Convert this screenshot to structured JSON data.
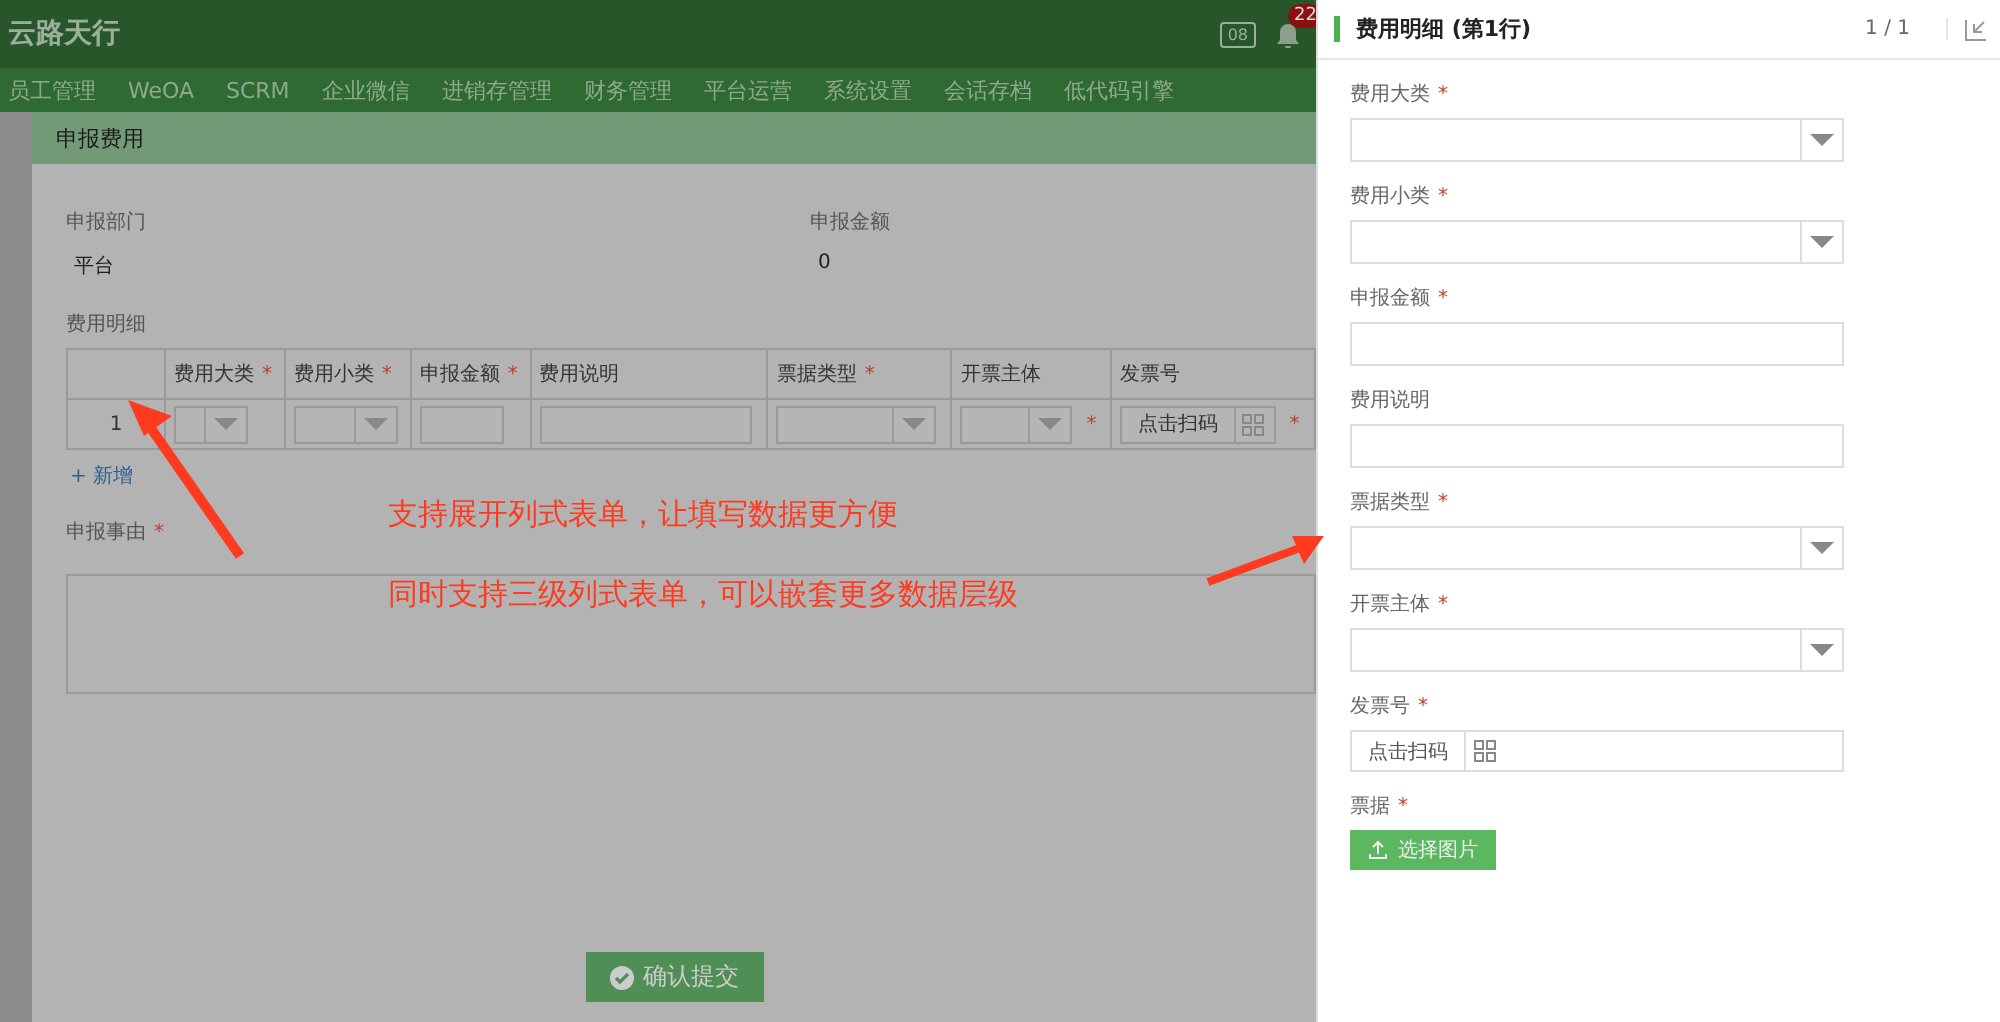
{
  "header": {
    "logo": "云路天行",
    "monitor_label": "08",
    "notification_count": "22"
  },
  "nav": {
    "items": [
      {
        "label": "员工管理"
      },
      {
        "label": "WeOA"
      },
      {
        "label": "SCRM"
      },
      {
        "label": "企业微信"
      },
      {
        "label": "进销存管理"
      },
      {
        "label": "财务管理"
      },
      {
        "label": "平台运营"
      },
      {
        "label": "系统设置"
      },
      {
        "label": "会话存档"
      },
      {
        "label": "低代码引擎"
      }
    ]
  },
  "modal": {
    "title": "申报费用",
    "fields": [
      {
        "label": "申报部门",
        "value": "平台"
      },
      {
        "label": "申报金额",
        "value": "0"
      }
    ],
    "detail_label": "费用明细",
    "table": {
      "columns": [
        {
          "label": "费用大类",
          "required_mark": "*",
          "kind": "select"
        },
        {
          "label": "费用小类",
          "required_mark": "*",
          "kind": "select"
        },
        {
          "label": "申报金额",
          "required_mark": "*",
          "kind": "input"
        },
        {
          "label": "费用说明",
          "kind": "input"
        },
        {
          "label": "票据类型",
          "required_mark": "*",
          "kind": "select"
        },
        {
          "label": "开票主体",
          "kind": "select"
        },
        {
          "label": "发票号",
          "kind": "scan"
        }
      ],
      "rows": [
        {
          "index": "1",
          "cells": [
            {},
            {},
            {},
            {},
            {},
            {
              "required_mark": "*"
            },
            {
              "required_mark": "*",
              "placeholder": "点击扫码"
            }
          ]
        }
      ]
    },
    "add_link": "+ 新增",
    "reason_label": "申报事由",
    "reason_required_mark": "*",
    "submit": "确认提交"
  },
  "annotations": [
    "支持展开列式表单，让填写数据更方便",
    "同时支持三级列式表单，可以嵌套更多数据层级"
  ],
  "drawer": {
    "title": "费用明细 (第1行)",
    "pager": "1 / 1",
    "fields": [
      {
        "label": "费用大类",
        "required_mark": "*",
        "kind": "select"
      },
      {
        "label": "费用小类",
        "required_mark": "*",
        "kind": "select"
      },
      {
        "label": "申报金额",
        "required_mark": "*",
        "kind": "input"
      },
      {
        "label": "费用说明",
        "kind": "input"
      },
      {
        "label": "票据类型",
        "required_mark": "*",
        "kind": "select"
      },
      {
        "label": "开票主体",
        "required_mark": "*",
        "kind": "select"
      },
      {
        "label": "发票号",
        "required_mark": "*",
        "kind": "scan",
        "placeholder": "点击扫码"
      },
      {
        "label": "票据",
        "required_mark": "*",
        "kind": "upload",
        "button": "选择图片"
      }
    ]
  }
}
